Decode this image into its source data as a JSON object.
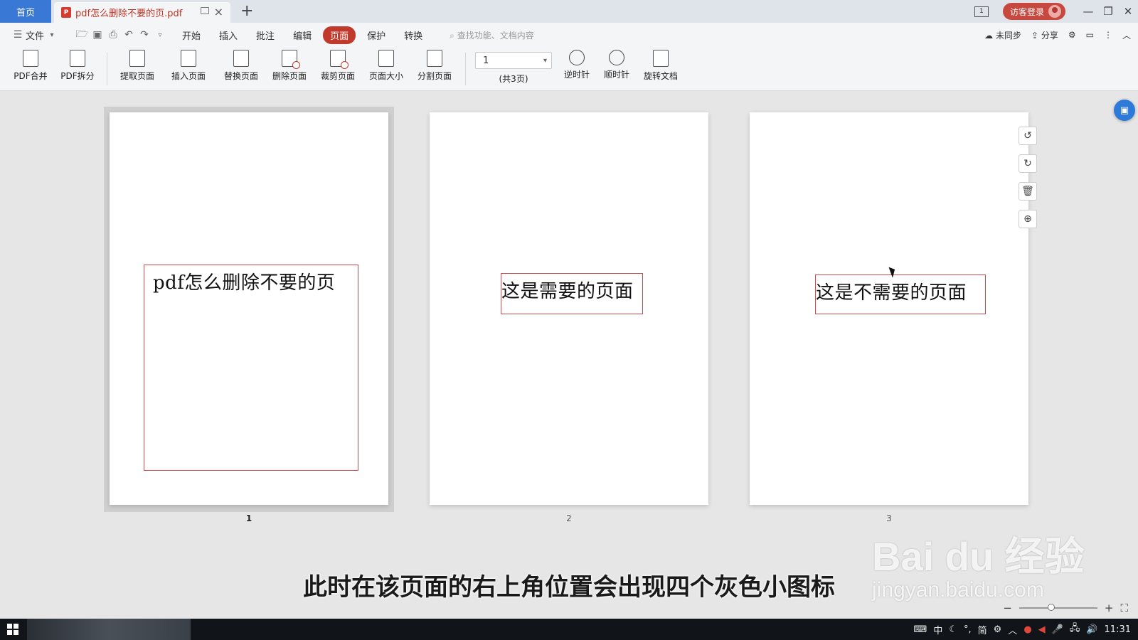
{
  "titlebar": {
    "home_tab": "首页",
    "doc_tab": "pdf怎么删除不要的页.pdf",
    "pdf_badge": "P",
    "new_tab": "+",
    "layout_badge": "1",
    "login": "访客登录",
    "minimize": "—",
    "restore": "❐",
    "close": "✕"
  },
  "menubar": {
    "file": "文件",
    "items": [
      "开始",
      "插入",
      "批注",
      "编辑",
      "页面",
      "保护",
      "转换"
    ],
    "active": "页面",
    "search_placeholder": "查找功能、文档内容",
    "sync": "未同步",
    "share": "分享"
  },
  "toolbar": {
    "tools": [
      "PDF合并",
      "PDF拆分",
      "提取页面",
      "插入页面",
      "替换页面",
      "删除页面",
      "裁剪页面",
      "页面大小",
      "分割页面"
    ],
    "page_value": "1",
    "page_total": "(共3页)",
    "rotate_ccw": "逆时针",
    "rotate_cw": "顺时针",
    "rotate_doc": "旋转文档"
  },
  "pages": [
    {
      "number": "1",
      "text": "pdf怎么删除不要的页",
      "selected": true
    },
    {
      "number": "2",
      "text": "这是需要的页面",
      "selected": false
    },
    {
      "number": "3",
      "text": "这是不需要的页面",
      "selected": false
    }
  ],
  "page_icons": [
    "rotate-ccw-icon",
    "rotate-cw-icon",
    "trash-icon",
    "zoom-in-icon"
  ],
  "subtitle": "此时在该页面的右上角位置会出现四个灰色小图标",
  "watermark": {
    "brand": "Bai du 经验",
    "url": "jingyan.baidu.com"
  },
  "taskbar": {
    "ime": [
      "中",
      "简"
    ],
    "time": "11:31"
  },
  "colors": {
    "accent": "#c0392b",
    "home_tab": "#3a78d6",
    "red_frame": "#c94b4b"
  }
}
